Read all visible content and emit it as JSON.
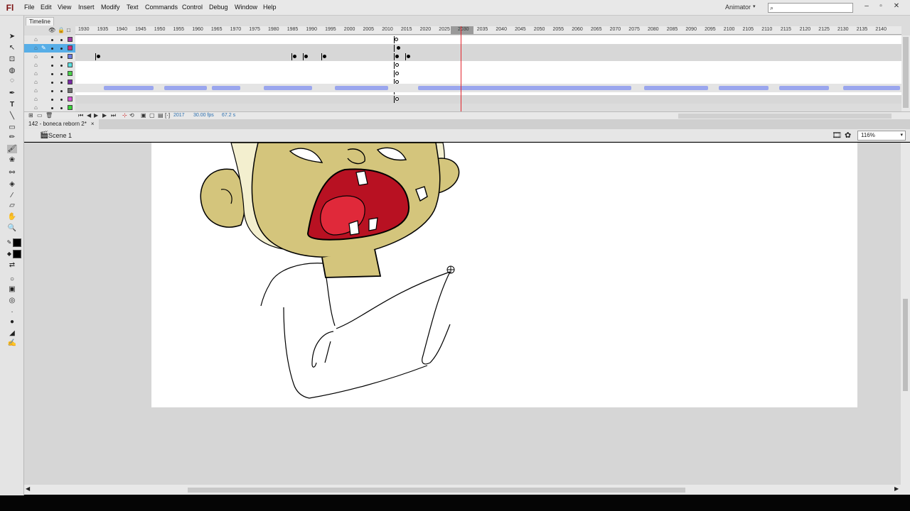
{
  "app": {
    "logo": "Fl"
  },
  "menu": [
    "File",
    "Edit",
    "View",
    "Insert",
    "Modify",
    "Text",
    "Commands",
    "Control",
    "Debug",
    "Window",
    "Help"
  ],
  "workspace": {
    "label": "Animator",
    "caret": "▾"
  },
  "search": {
    "placeholder": "",
    "icon": "⌕"
  },
  "window_buttons": {
    "minimize": "–",
    "maximize": "▫",
    "close": "✕"
  },
  "timeline": {
    "tab_label": "Timeline",
    "ruler": [
      "1930",
      "1935",
      "1940",
      "1945",
      "1950",
      "1955",
      "1960",
      "1965",
      "1970",
      "1975",
      "1980",
      "1985",
      "1990",
      "1995",
      "2000",
      "2005",
      "2010",
      "2015",
      "2020",
      "2025",
      "2030",
      "2035",
      "2040",
      "2045",
      "2050",
      "2055",
      "2060",
      "2065",
      "2070",
      "2075",
      "2080",
      "2085",
      "2090",
      "2095",
      "2100",
      "2105",
      "2110",
      "2115",
      "2120",
      "2125",
      "2130",
      "2135",
      "2140"
    ],
    "layers": [
      {
        "color": "#a238a6"
      },
      {
        "color": "#cf2d7d"
      },
      {
        "color": "#6b7be0"
      },
      {
        "color": "#59e0e0"
      },
      {
        "color": "#4ad24a"
      },
      {
        "color": "#7a2aa6"
      },
      {
        "color": "#707070"
      },
      {
        "color": "#d94fd6"
      },
      {
        "color": "#38d438"
      }
    ],
    "footer": {
      "current_frame": "2017",
      "fps": "30.00 fps",
      "time": "67.2 s"
    }
  },
  "document": {
    "tab_label": "142 - boneca reborn 2*",
    "tab_close": "×",
    "scene_label": "Scene 1",
    "zoom": "116%"
  },
  "icons": {
    "eye": "👁",
    "lock": "🔒",
    "outline": "□",
    "layer": "⌂",
    "pencil": "✎",
    "scene": "🎬"
  }
}
